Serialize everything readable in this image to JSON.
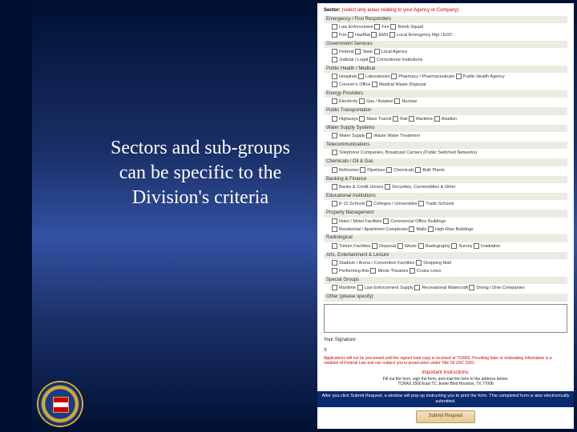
{
  "caption": "Sectors and sub-groups can be specific to the Division's criteria",
  "sector_label": "Sector:",
  "sector_hint": "(select only areas relating to your Agency or Company)",
  "categories": [
    {
      "name": "Emergency / First Responders",
      "rows": [
        [
          "Law Enforcement",
          "Fire",
          "Bomb Squad"
        ],
        [
          "Fire",
          "HazMat",
          "EMS",
          "Local Emergency Mgt / EOC"
        ]
      ]
    },
    {
      "name": "Government Services",
      "rows": [
        [
          "Federal",
          "State",
          "Local Agency"
        ],
        [
          "Judicial / Legal",
          "Correctional Institutions"
        ]
      ]
    },
    {
      "name": "Public Health / Medical",
      "rows": [
        [
          "Hospitals",
          "Laboratories",
          "Pharmacy / Pharmaceuticals",
          "Public Health Agency"
        ],
        [
          "Coroner's Office",
          "Medical Waste Disposal"
        ]
      ]
    },
    {
      "name": "Energy Providers",
      "rows": [
        [
          "Electricity",
          "Gas / Aviation",
          "Nuclear"
        ]
      ]
    },
    {
      "name": "Public Transportation",
      "rows": [
        [
          "Highways",
          "Mass Transit",
          "Rail",
          "Maritime",
          "Aviation"
        ]
      ]
    },
    {
      "name": "Water Supply Systems",
      "rows": [
        [
          "Water Supply",
          "Waste Water Treatment"
        ]
      ]
    },
    {
      "name": "Telecommunications",
      "rows": [
        [
          "Telephone Companies, Broadcast Carriers (Public Switched Networks)"
        ]
      ]
    },
    {
      "name": "Chemicals / Oil & Gas",
      "rows": [
        [
          "Refineries",
          "Pipelines",
          "Chemicals",
          "Bulk Plants"
        ]
      ]
    },
    {
      "name": "Banking & Finance",
      "rows": [
        [
          "Banks & Credit Unions",
          "Securities, Commodities & Other"
        ]
      ]
    },
    {
      "name": "Educational Institutions",
      "rows": [
        [
          "K-12 Schools",
          "Colleges / Universities",
          "Trade Schools"
        ]
      ]
    },
    {
      "name": "Property Management",
      "rows": [
        [
          "Hotel / Motel Facilities",
          "Commercial Office Buildings"
        ],
        [
          "Residential / Apartment Complexes",
          "Malls",
          "High-Rise Buildings"
        ]
      ]
    },
    {
      "name": "Radiological",
      "rows": [
        [
          "Tritium Facilities",
          "Disposal",
          "Waste",
          "Radiography",
          "Survey",
          "Irradiation"
        ]
      ]
    },
    {
      "name": "Arts, Entertainment & Leisure",
      "rows": [
        [
          "Stadium / Arena / Convention Facilities",
          "Shopping Mall"
        ],
        [
          "Performing Arts",
          "Movie Theatres",
          "Cruise Lines"
        ]
      ]
    },
    {
      "name": "Special Groups",
      "rows": [
        [
          "Maritime",
          "Law Enforcement Supply",
          "Recreational Watercraft",
          "Diving / Dive Companies"
        ]
      ]
    },
    {
      "name": "Other (please specify)",
      "rows": []
    }
  ],
  "signature_label": "Your Signature:",
  "x_label": "X",
  "warning": "Applications will not be processed until the signed hard copy is received at TCRAS. Providing false or misleading information is a violation of Federal Law and can subject you to prosecution under Title 18 USC 1001.",
  "instructions_title": "Important Instructions:",
  "instructions_line1": "Fill out the form, sign the form, and mail the form to the address below:",
  "instructions_line2": "TCRAS 2500 East TC Jester Blvd Houston, TX 77008",
  "blue_bar": "After you click Submit Request, a window will pop-up instructing you to print the form. This completed form is also electronically submitted.",
  "submit_label": "Submit Request"
}
